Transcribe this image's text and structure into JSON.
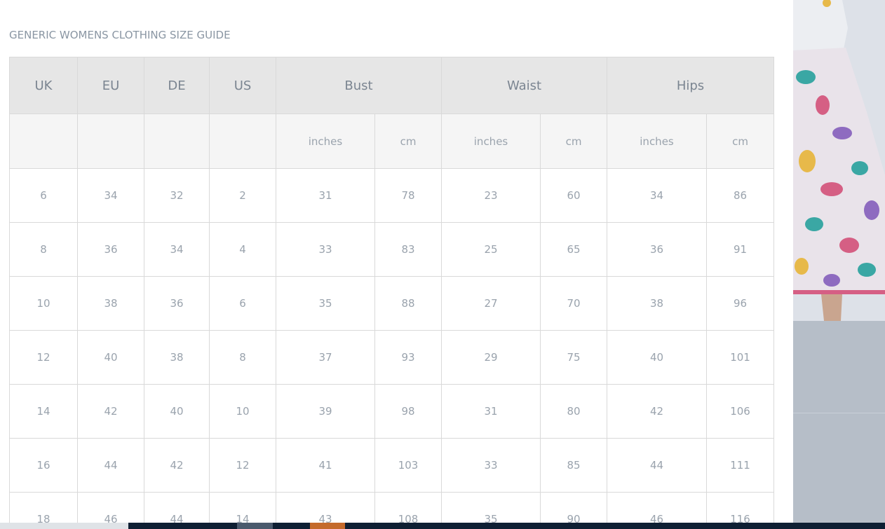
{
  "modal": {
    "title": "GENERIC WOMENS CLOTHING SIZE GUIDE"
  },
  "table": {
    "headers": {
      "uk": "UK",
      "eu": "EU",
      "de": "DE",
      "us": "US",
      "bust": "Bust",
      "waist": "Waist",
      "hips": "Hips"
    },
    "units": {
      "inches": "inches",
      "cm": "cm"
    },
    "rows": [
      [
        "6",
        "34",
        "32",
        "2",
        "31",
        "78",
        "23",
        "60",
        "34",
        "86"
      ],
      [
        "8",
        "36",
        "34",
        "4",
        "33",
        "83",
        "25",
        "65",
        "36",
        "91"
      ],
      [
        "10",
        "38",
        "36",
        "6",
        "35",
        "88",
        "27",
        "70",
        "38",
        "96"
      ],
      [
        "12",
        "40",
        "38",
        "8",
        "37",
        "93",
        "29",
        "75",
        "40",
        "101"
      ],
      [
        "14",
        "42",
        "40",
        "10",
        "39",
        "98",
        "31",
        "80",
        "42",
        "106"
      ],
      [
        "16",
        "44",
        "42",
        "12",
        "41",
        "103",
        "33",
        "85",
        "44",
        "111"
      ],
      [
        "18",
        "46",
        "44",
        "14",
        "43",
        "108",
        "35",
        "90",
        "46",
        "116"
      ]
    ]
  },
  "colors": {
    "header_bg": "#e6e6e6",
    "units_bg": "#f5f5f5",
    "border": "#d9d9d9",
    "title_text": "#8a96a3",
    "cell_text": "#9aa3ad",
    "overlay": "#b6bec8",
    "bottom_bar": "#0e1f33",
    "accent": "#c46a2b"
  }
}
